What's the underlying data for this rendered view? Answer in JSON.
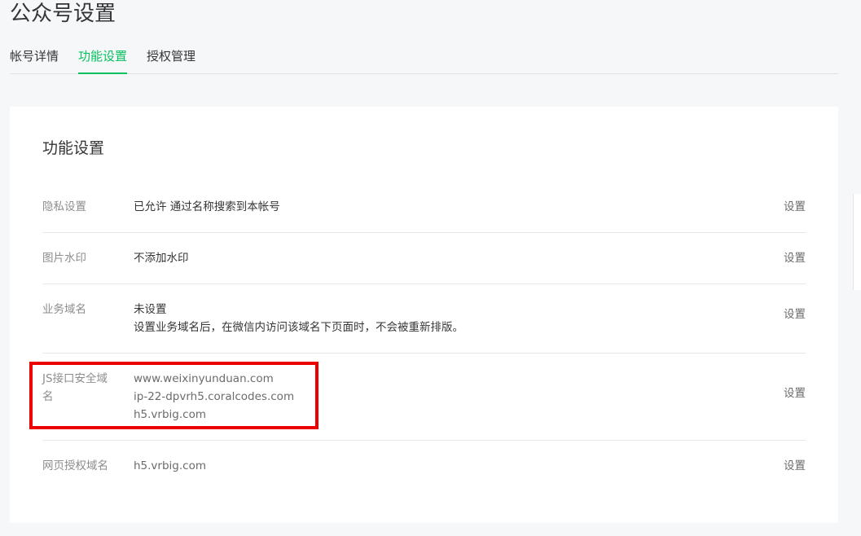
{
  "page": {
    "title": "公众号设置"
  },
  "tabs": [
    {
      "label": "帐号详情",
      "active": false
    },
    {
      "label": "功能设置",
      "active": true
    },
    {
      "label": "授权管理",
      "active": false
    }
  ],
  "card": {
    "title": "功能设置",
    "rows": [
      {
        "label": "隐私设置",
        "lines": [
          "已允许 通过名称搜索到本帐号"
        ],
        "action": "设置"
      },
      {
        "label": "图片水印",
        "lines": [
          "不添加水印"
        ],
        "action": "设置"
      },
      {
        "label": "业务域名",
        "lines": [
          "未设置",
          "设置业务域名后，在微信内访问该域名下页面时，不会被重新排版。"
        ],
        "action": "设置"
      },
      {
        "label": "JS接口安全域名",
        "label_lines": [
          "JS接口安全域",
          "名"
        ],
        "lines": [
          "www.weixinyunduan.com",
          "ip-22-dpvrh5.coralcodes.com",
          "h5.vrbig.com"
        ],
        "action": "设置"
      },
      {
        "label": "网页授权域名",
        "lines": [
          "h5.vrbig.com"
        ],
        "action": "设置"
      }
    ]
  },
  "colors": {
    "accent": "#07c160",
    "highlight": "#ea0000"
  }
}
